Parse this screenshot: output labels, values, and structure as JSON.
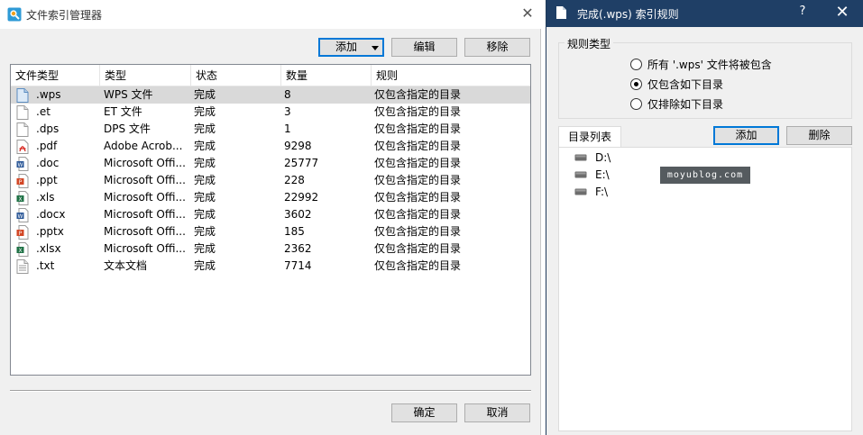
{
  "left_window": {
    "title": "文件索引管理器",
    "toolbar": {
      "add_label": "添加",
      "edit_label": "编辑",
      "remove_label": "移除"
    },
    "columns": [
      "文件类型",
      "类型",
      "状态",
      "数量",
      "规则"
    ],
    "rows": [
      {
        "ext": ".wps",
        "type": "WPS 文件",
        "status": "完成",
        "count": "8",
        "rule": "仅包含指定的目录",
        "icon": "wps-doc-icon"
      },
      {
        "ext": ".et",
        "type": "ET 文件",
        "status": "完成",
        "count": "3",
        "rule": "仅包含指定的目录",
        "icon": "blank-doc-icon"
      },
      {
        "ext": ".dps",
        "type": "DPS 文件",
        "status": "完成",
        "count": "1",
        "rule": "仅包含指定的目录",
        "icon": "blank-doc-icon"
      },
      {
        "ext": ".pdf",
        "type": "Adobe Acrob...",
        "status": "完成",
        "count": "9298",
        "rule": "仅包含指定的目录",
        "icon": "pdf-icon"
      },
      {
        "ext": ".doc",
        "type": "Microsoft Offi...",
        "status": "完成",
        "count": "25777",
        "rule": "仅包含指定的目录",
        "icon": "word-icon"
      },
      {
        "ext": ".ppt",
        "type": "Microsoft Offi...",
        "status": "完成",
        "count": "228",
        "rule": "仅包含指定的目录",
        "icon": "powerpoint-icon"
      },
      {
        "ext": ".xls",
        "type": "Microsoft Offi...",
        "status": "完成",
        "count": "22992",
        "rule": "仅包含指定的目录",
        "icon": "excel-icon"
      },
      {
        "ext": ".docx",
        "type": "Microsoft Offi...",
        "status": "完成",
        "count": "3602",
        "rule": "仅包含指定的目录",
        "icon": "word-icon"
      },
      {
        "ext": ".pptx",
        "type": "Microsoft Offi...",
        "status": "完成",
        "count": "185",
        "rule": "仅包含指定的目录",
        "icon": "powerpoint-icon"
      },
      {
        "ext": ".xlsx",
        "type": "Microsoft Offi...",
        "status": "完成",
        "count": "2362",
        "rule": "仅包含指定的目录",
        "icon": "excel-icon"
      },
      {
        "ext": ".txt",
        "type": "文本文档",
        "status": "完成",
        "count": "7714",
        "rule": "仅包含指定的目录",
        "icon": "text-doc-icon"
      }
    ],
    "selected_row": 0,
    "footer": {
      "ok_label": "确定",
      "cancel_label": "取消"
    }
  },
  "right_window": {
    "title": "完成(.wps) 索引规则",
    "help_label": "?",
    "close_label": "✕",
    "rule_group": {
      "legend": "规则类型",
      "options": [
        {
          "label": "所有 '.wps' 文件将被包含",
          "checked": false
        },
        {
          "label": "仅包含如下目录",
          "checked": true
        },
        {
          "label": "仅排除如下目录",
          "checked": false
        }
      ]
    },
    "dir_tab_label": "目录列表",
    "add_label": "添加",
    "delete_label": "删除",
    "directories": [
      "D:\\",
      "E:\\",
      "F:\\"
    ]
  },
  "watermark": "moyublog.com",
  "colors": {
    "accent": "#0078d7",
    "titlebar": "#1f3f66",
    "selected_row": "#d9d9d9"
  }
}
